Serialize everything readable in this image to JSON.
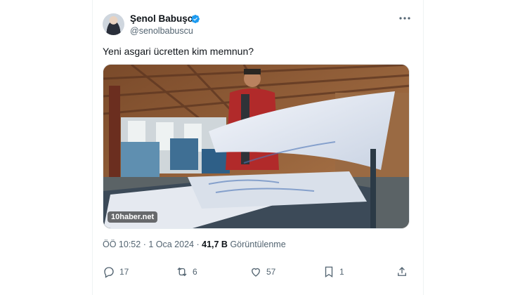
{
  "author": {
    "name": "Şenol Babuşcu",
    "handle": "@senolbabuscu",
    "verified": true
  },
  "tweet": {
    "text": "Yeni asgari ücretten kim memnun?",
    "media_source": "10haber.net"
  },
  "meta": {
    "time": "ÖÖ 10:52",
    "separator": "·",
    "date": "1 Oca 2024",
    "views_count": "41,7 B",
    "views_label": "Görüntülenme"
  },
  "actions": {
    "replies": "17",
    "retweets": "6",
    "likes": "57",
    "bookmarks": "1"
  },
  "icons": {
    "more": "more-icon",
    "reply": "reply-icon",
    "retweet": "retweet-icon",
    "like": "heart-icon",
    "bookmark": "bookmark-icon",
    "share": "share-icon",
    "verified": "verified-badge-icon"
  },
  "colors": {
    "verified": "#1d9bf0",
    "secondary_text": "#536471",
    "primary_text": "#0f1419"
  }
}
